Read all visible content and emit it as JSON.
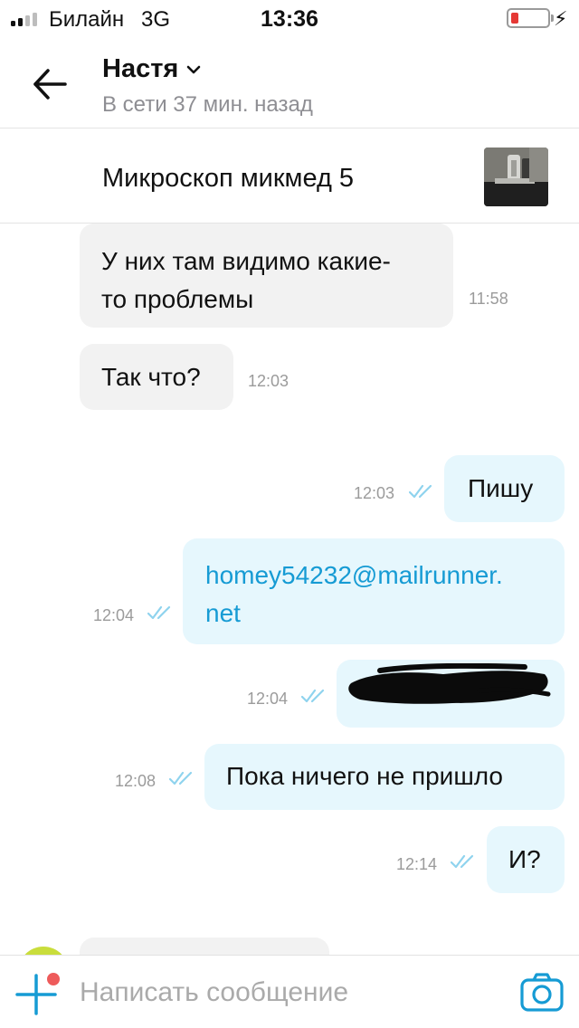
{
  "status_bar": {
    "carrier": "Билайн",
    "network": "3G",
    "time": "13:36",
    "signal_bars": 4,
    "signal_bars_active": 2,
    "battery_level": 0.2,
    "charging_icon": "⚡"
  },
  "header": {
    "back_icon": "arrow-left-icon",
    "contact_name": "Настя",
    "contact_status": "В сети 37 мин. назад"
  },
  "listing": {
    "title": "Микроскоп микмед 5",
    "thumbnail_icon": "microscope-photo"
  },
  "messages": [
    {
      "direction": "incoming",
      "lines": [
        "У них там видимо какие-",
        "то проблемы"
      ],
      "time": "11:58"
    },
    {
      "direction": "incoming",
      "lines": [
        "Так что?"
      ],
      "time": "12:03"
    },
    {
      "direction": "outgoing",
      "lines": [
        "Пишу"
      ],
      "time": "12:03",
      "read": true
    },
    {
      "direction": "outgoing",
      "lines": [
        "homey54232@mailrunner.",
        "net"
      ],
      "time": "12:04",
      "read": true,
      "is_link": true
    },
    {
      "direction": "outgoing",
      "lines": [],
      "time": "12:04",
      "read": true,
      "redacted": true
    },
    {
      "direction": "outgoing",
      "lines": [
        "Пока ничего не пришло"
      ],
      "time": "12:08",
      "read": true
    },
    {
      "direction": "outgoing",
      "lines": [
        "И?"
      ],
      "time": "12:14",
      "read": true
    }
  ],
  "composer": {
    "placeholder": "Написать сообщение",
    "add_icon": "plus-icon",
    "camera_icon": "camera-icon"
  },
  "colors": {
    "accent": "#169bd4",
    "incoming_bubble": "#f2f2f2",
    "outgoing_bubble": "#e6f7fd",
    "time_text": "#9b9b9b",
    "status_text": "#8e8e93",
    "notification_dot": "#ee5b5b",
    "battery_low": "#e53935"
  }
}
